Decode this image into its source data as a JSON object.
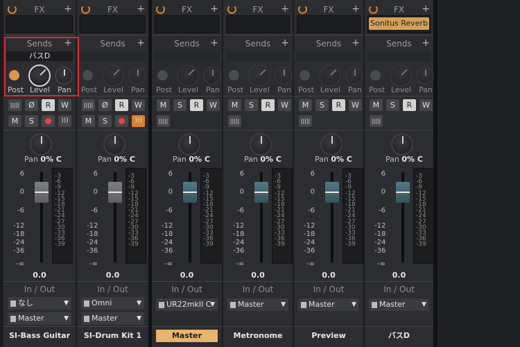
{
  "labels": {
    "fx": "FX",
    "sends": "Sends",
    "post": "Post",
    "level": "Level",
    "pan": "Pan",
    "pan_value": "0% C",
    "in_out": "In / Out",
    "fader_value": "0.0",
    "plus": "+"
  },
  "buttons": {
    "mute": "M",
    "solo": "S",
    "read": "R",
    "write": "W",
    "phase": "Ø"
  },
  "fader_scale": [
    "6",
    "0",
    "-6",
    "-12",
    "-18",
    "-24",
    "-36",
    "-∞"
  ],
  "meter_scale": [
    "-3",
    "-6",
    "-9",
    "-12",
    "-15",
    "-18",
    "-21",
    "-24",
    "-27",
    "-30",
    "-33",
    "-36",
    "-39"
  ],
  "channels": [
    {
      "name": "SI-Bass Guitar",
      "send_slot": "バスD",
      "input": "なし",
      "output": "Master"
    },
    {
      "name": "SI-Drum Kit 1",
      "input": "Omni",
      "output": "Master"
    },
    {
      "name": "Master",
      "output": "UR22mkII C"
    },
    {
      "name": "Metronome",
      "output": "Master"
    },
    {
      "name": "Preview",
      "output": "Master"
    },
    {
      "name": "バスD",
      "insert": "Sonitus Reverb",
      "output": "Master"
    }
  ],
  "colors": {
    "accent_orange": "#d9822b",
    "highlight_name": "#e8b46e",
    "selection_red": "#e0283a"
  }
}
